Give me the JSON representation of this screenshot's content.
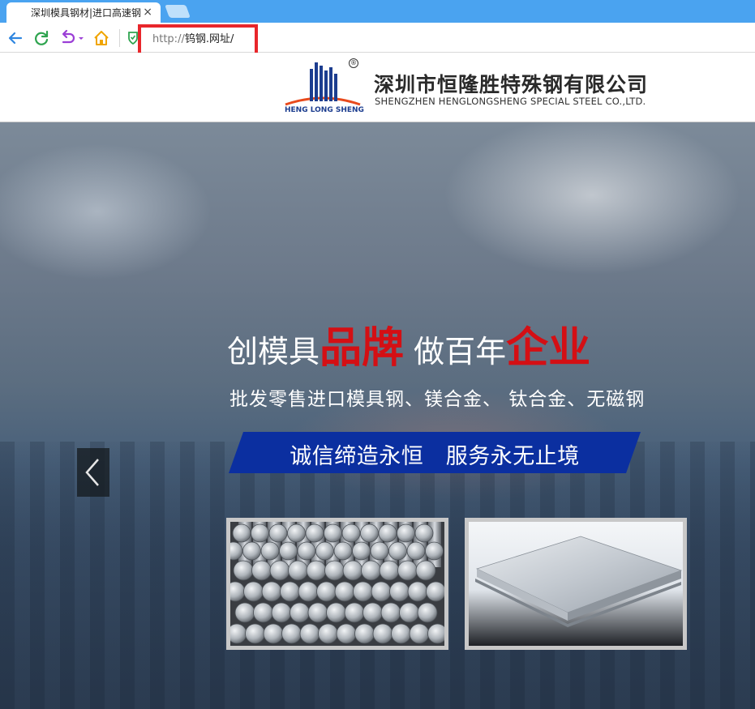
{
  "browser": {
    "tab_title": "深圳模具钢材|进口高速钢",
    "tab_close": "×",
    "address_prefix": "http://",
    "address_host": "钨钢.网址/",
    "icons": [
      "back-icon",
      "reload-icon",
      "undo-icon",
      "home-icon",
      "shield-icon"
    ],
    "colors": {
      "tabstrip": "#4aa3f0",
      "highlight": "#e8262b"
    }
  },
  "site": {
    "logo_caption": "HENG LONG SHENG",
    "registered_mark": "®",
    "company_cn": "深圳市恒隆胜特殊钢有限公司",
    "company_en": "SHENGZHEN HENGLONGSHENG SPECIAL STEEL CO.,LTD."
  },
  "hero": {
    "slogan_part1": "创模具",
    "slogan_red1": "品牌",
    "slogan_part2": " 做百年",
    "slogan_red2": "企业",
    "sub_slogan": "批发零售进口模具钢、镁合金、 钛合金、无磁钢",
    "banner_text": "诚信缔造永恒　服务永无止境",
    "colors": {
      "red": "#d40f14",
      "banner": "#0b2fa0"
    }
  }
}
